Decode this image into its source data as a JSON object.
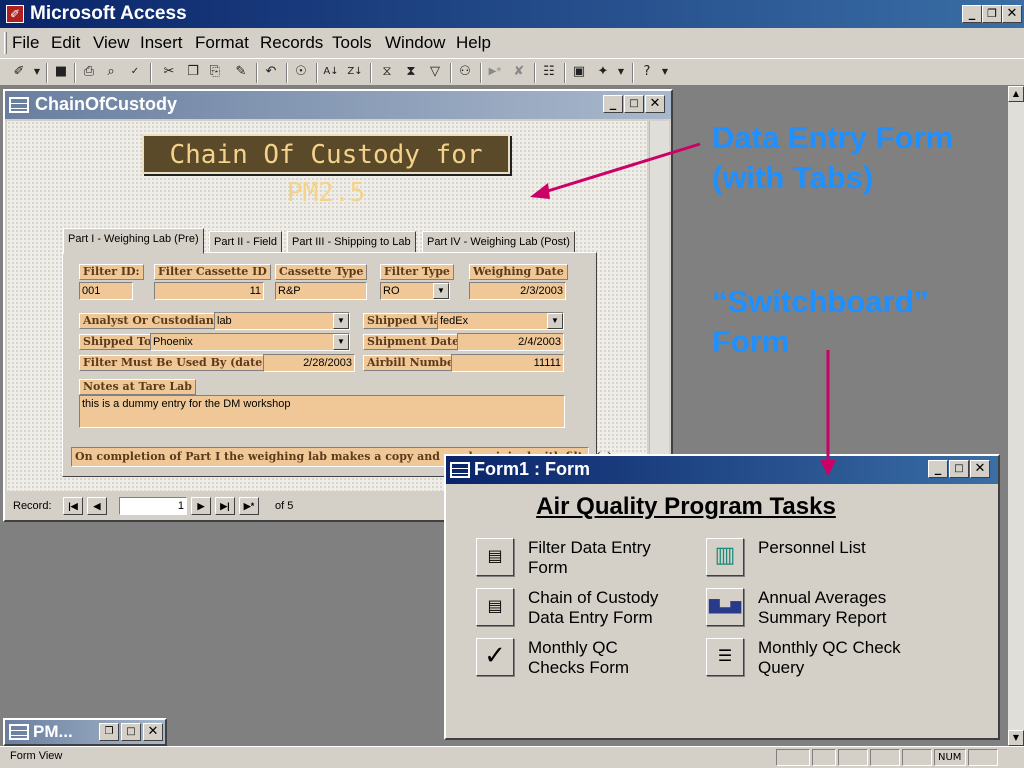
{
  "app": {
    "title": "Microsoft Access"
  },
  "menus": [
    "File",
    "Edit",
    "View",
    "Insert",
    "Format",
    "Records",
    "Tools",
    "Window",
    "Help"
  ],
  "toolbar_icons": [
    "view-design-icon",
    "save-icon",
    "print-icon",
    "print-preview-icon",
    "spelling-icon",
    "cut-icon",
    "copy-icon",
    "paste-icon",
    "format-painter-icon",
    "undo-icon",
    "hyperlink-icon",
    "sort-ascending-icon",
    "sort-descending-icon",
    "filter-by-selection-icon",
    "filter-by-form-icon",
    "apply-filter-icon",
    "find-icon",
    "new-record-icon",
    "delete-record-icon",
    "properties-icon",
    "database-window-icon",
    "new-object-icon",
    "help-icon"
  ],
  "coc_window": {
    "title": "ChainOfCustody",
    "heading": "Chain Of Custody for PM2.5",
    "tabs": [
      "Part I - Weighing Lab (Pre)",
      "Part II - Field",
      "Part III - Shipping to Lab",
      "Part IV - Weighing Lab (Post)"
    ],
    "fields": {
      "filter_id_label": "Filter ID:",
      "filter_id_value": "001",
      "cassette_id_label": "Filter Cassette ID",
      "cassette_id_value": "11",
      "cassette_type_label": "Cassette Type",
      "cassette_type_value": "R&P",
      "filter_type_label": "Filter Type",
      "filter_type_value": "RO",
      "weighing_date_label": "Weighing Date",
      "weighing_date_value": "2/3/2003",
      "analyst_label": "Analyst Or Custodian",
      "analyst_value": "lab",
      "shipped_to_label": "Shipped To",
      "shipped_to_value": "Phoenix",
      "must_use_by_label": "Filter Must Be Used By (date)",
      "must_use_by_value": "2/28/2003",
      "shipped_via_label": "Shipped Via",
      "shipped_via_value": "fedEx",
      "shipment_date_label": "Shipment Date",
      "shipment_date_value": "2/4/2003",
      "airbill_label": "Airbill Number",
      "airbill_value": "11111",
      "notes_label": "Notes at Tare Lab",
      "notes_value": "this is a dummy entry for the DM workshop"
    },
    "completion_note": "On completion of Part I the weighing lab makes a copy and sends original with filter(s).",
    "record_nav": {
      "label": "Record:",
      "current": "1",
      "of_text": "of 5"
    }
  },
  "form1_window": {
    "title": "Form1 : Form",
    "heading": "Air Quality Program Tasks",
    "items": [
      {
        "line1": "Filter Data Entry",
        "line2": "Form",
        "icon": "form-icon"
      },
      {
        "line1": "Chain of Custody",
        "line2": "Data Entry Form",
        "icon": "form-icon"
      },
      {
        "line1": "Monthly QC",
        "line2": "Checks Form",
        "icon": "checkmark-icon"
      },
      {
        "line1": "Personnel List",
        "line2": "",
        "icon": "notebook-icon"
      },
      {
        "line1": "Annual Averages",
        "line2": "Summary Report",
        "icon": "bar-chart-icon"
      },
      {
        "line1": "Monthly QC Check",
        "line2": "Query",
        "icon": "query-icon"
      }
    ]
  },
  "minimized_window": {
    "title": "PM..."
  },
  "annotations": {
    "data_entry_line1": "Data Entry Form",
    "data_entry_line2": "(with Tabs)",
    "switchboard_line1": "“Switchboard”",
    "switchboard_line2": "Form",
    "color": "#1e90ff",
    "arrow_color": "#cc0066"
  },
  "status_bar": {
    "text": "Form View",
    "num": "NUM"
  }
}
